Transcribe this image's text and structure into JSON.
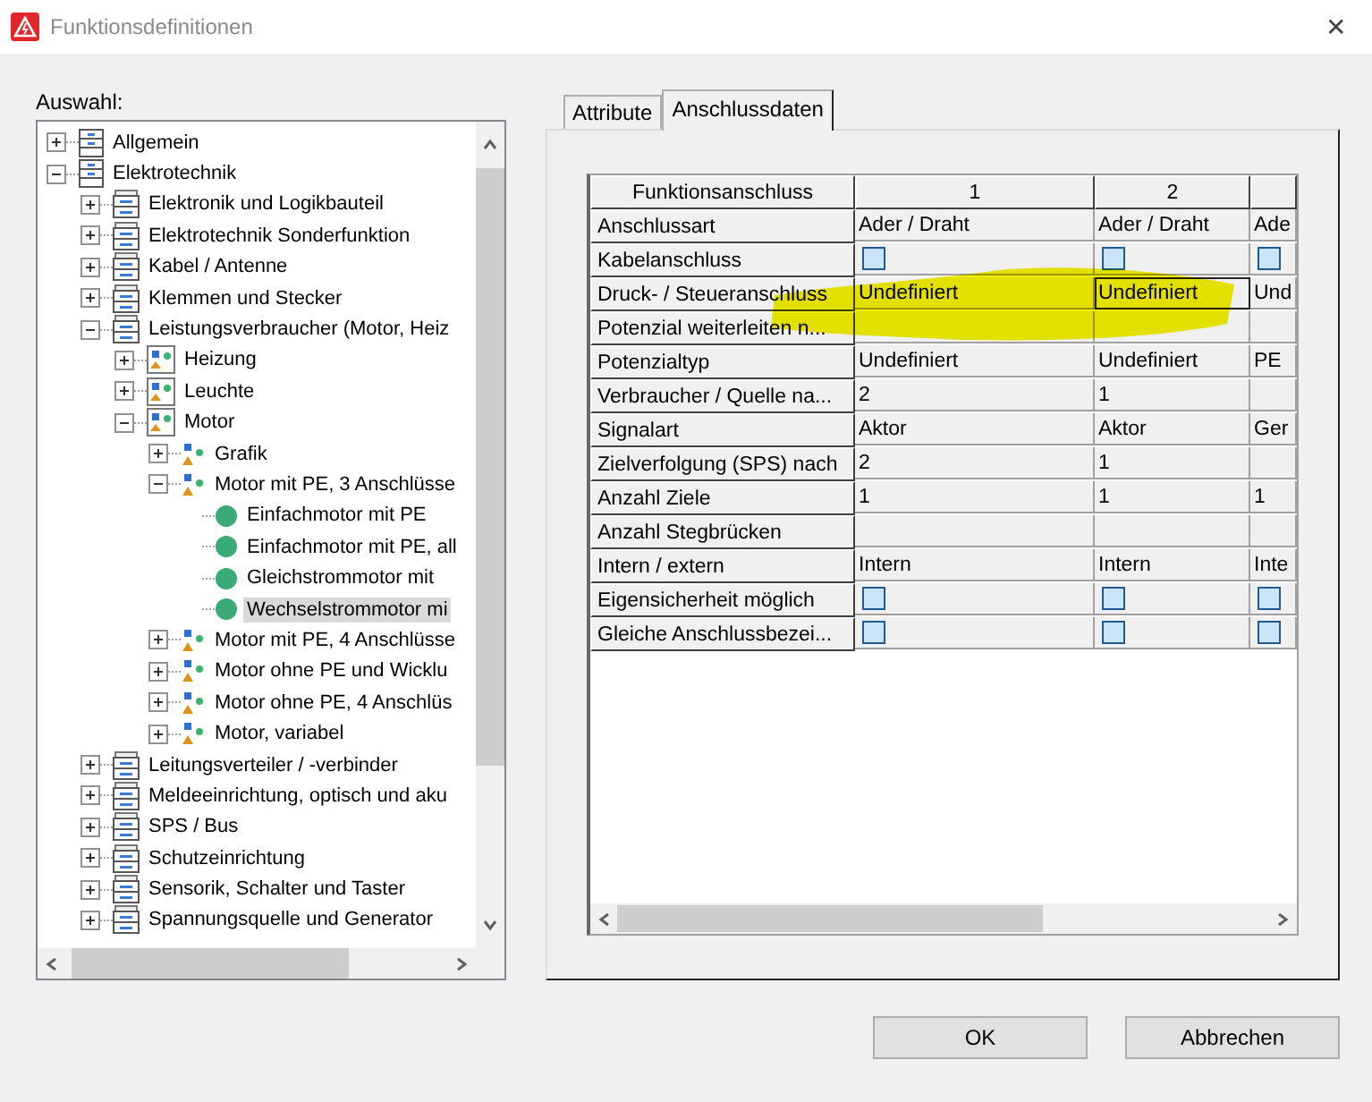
{
  "window": {
    "title": "Funktionsdefinitionen",
    "close": "✕"
  },
  "tree": {
    "label": "Auswahl:",
    "items": [
      {
        "label": "Allgemein",
        "kind": "folder",
        "expanded": false,
        "selected": false
      },
      {
        "label": "Elektrotechnik",
        "kind": "folder",
        "expanded": true,
        "selected": false,
        "children": [
          {
            "label": "Elektronik und Logikbauteil",
            "kind": "cabinet",
            "expanded": false,
            "selected": false
          },
          {
            "label": "Elektrotechnik Sonderfunktion",
            "kind": "cabinet",
            "expanded": false,
            "selected": false
          },
          {
            "label": "Kabel / Antenne",
            "kind": "cabinet",
            "expanded": false,
            "selected": false
          },
          {
            "label": "Klemmen und Stecker",
            "kind": "cabinet",
            "expanded": false,
            "selected": false
          },
          {
            "label": "Leistungsverbraucher (Motor, Heiz",
            "kind": "cabinet",
            "expanded": true,
            "selected": false,
            "children": [
              {
                "label": "Heizung",
                "kind": "group",
                "expanded": false,
                "selected": false
              },
              {
                "label": "Leuchte",
                "kind": "group",
                "expanded": false,
                "selected": false
              },
              {
                "label": "Motor",
                "kind": "group",
                "expanded": true,
                "selected": false,
                "children": [
                  {
                    "label": "Grafik",
                    "kind": "shape",
                    "expanded": false,
                    "selected": false
                  },
                  {
                    "label": "Motor mit PE, 3 Anschlüsse",
                    "kind": "shape",
                    "expanded": true,
                    "selected": false,
                    "children": [
                      {
                        "label": "Einfachmotor mit PE",
                        "kind": "dot",
                        "selected": false
                      },
                      {
                        "label": "Einfachmotor mit PE, all",
                        "kind": "dot",
                        "selected": false
                      },
                      {
                        "label": "Gleichstrommotor mit",
                        "kind": "dot",
                        "selected": false
                      },
                      {
                        "label": "Wechselstrommotor mi",
                        "kind": "dot",
                        "selected": true
                      }
                    ]
                  },
                  {
                    "label": "Motor mit PE, 4 Anschlüsse",
                    "kind": "shape",
                    "expanded": false,
                    "selected": false
                  },
                  {
                    "label": "Motor ohne PE und Wicklu",
                    "kind": "shape",
                    "expanded": false,
                    "selected": false
                  },
                  {
                    "label": "Motor ohne PE, 4 Anschlüs",
                    "kind": "shape",
                    "expanded": false,
                    "selected": false
                  },
                  {
                    "label": "Motor, variabel",
                    "kind": "shape",
                    "expanded": false,
                    "selected": false
                  }
                ]
              }
            ]
          },
          {
            "label": "Leitungsverteiler / -verbinder",
            "kind": "cabinet",
            "expanded": false,
            "selected": false
          },
          {
            "label": "Meldeeinrichtung, optisch und aku",
            "kind": "cabinet",
            "expanded": false,
            "selected": false
          },
          {
            "label": "SPS / Bus",
            "kind": "cabinet",
            "expanded": false,
            "selected": false
          },
          {
            "label": "Schutzeinrichtung",
            "kind": "cabinet",
            "expanded": false,
            "selected": false
          },
          {
            "label": "Sensorik, Schalter und Taster",
            "kind": "cabinet",
            "expanded": false,
            "selected": false
          },
          {
            "label": "Spannungsquelle und Generator",
            "kind": "cabinet",
            "expanded": false,
            "selected": false
          }
        ]
      }
    ]
  },
  "tabs": [
    {
      "label": "Attribute",
      "selected": false
    },
    {
      "label": "Anschlussdaten",
      "selected": true
    }
  ],
  "table": {
    "columns": [
      "Funktionsanschluss",
      "1",
      "2"
    ],
    "rows": [
      {
        "label": "Anschlussart",
        "cells": [
          {
            "kind": "text",
            "text": "Ader / Draht"
          },
          {
            "kind": "text",
            "text": "Ader / Draht"
          },
          {
            "kind": "text",
            "text": "Ade"
          }
        ]
      },
      {
        "label": "Kabelanschluss",
        "cells": [
          {
            "kind": "checkbox",
            "checked": false
          },
          {
            "kind": "checkbox",
            "checked": false
          },
          {
            "kind": "checkbox",
            "checked": false
          }
        ]
      },
      {
        "label": "Druck- / Steueranschluss",
        "cells": [
          {
            "kind": "text",
            "text": "Undefiniert"
          },
          {
            "kind": "text",
            "text": "Undefiniert",
            "focused": true
          },
          {
            "kind": "text",
            "text": "Und"
          }
        ]
      },
      {
        "label": "Potenzial weiterleiten n...",
        "cells": [
          {
            "kind": "empty"
          },
          {
            "kind": "empty"
          },
          {
            "kind": "empty"
          }
        ]
      },
      {
        "label": "Potenzialtyp",
        "cells": [
          {
            "kind": "text",
            "text": "Undefiniert"
          },
          {
            "kind": "text",
            "text": "Undefiniert"
          },
          {
            "kind": "text",
            "text": "PE"
          }
        ]
      },
      {
        "label": "Verbraucher / Quelle na...",
        "cells": [
          {
            "kind": "text",
            "text": "2"
          },
          {
            "kind": "text",
            "text": "1"
          },
          {
            "kind": "empty"
          }
        ]
      },
      {
        "label": "Signalart",
        "cells": [
          {
            "kind": "text",
            "text": "Aktor"
          },
          {
            "kind": "text",
            "text": "Aktor"
          },
          {
            "kind": "text",
            "text": "Ger"
          }
        ]
      },
      {
        "label": "Zielverfolgung (SPS) nach",
        "cells": [
          {
            "kind": "text",
            "text": "2"
          },
          {
            "kind": "text",
            "text": "1"
          },
          {
            "kind": "empty"
          }
        ]
      },
      {
        "label": "Anzahl Ziele",
        "cells": [
          {
            "kind": "text",
            "text": "1"
          },
          {
            "kind": "text",
            "text": "1"
          },
          {
            "kind": "text",
            "text": "1"
          }
        ]
      },
      {
        "label": "Anzahl Stegbrücken",
        "cells": [
          {
            "kind": "empty"
          },
          {
            "kind": "empty"
          },
          {
            "kind": "empty"
          }
        ]
      },
      {
        "label": "Intern / extern",
        "cells": [
          {
            "kind": "text",
            "text": "Intern"
          },
          {
            "kind": "text",
            "text": "Intern"
          },
          {
            "kind": "text",
            "text": "Inte"
          }
        ]
      },
      {
        "label": "Eigensicherheit möglich",
        "cells": [
          {
            "kind": "checkbox",
            "checked": false
          },
          {
            "kind": "checkbox",
            "checked": false
          },
          {
            "kind": "checkbox",
            "checked": false
          }
        ]
      },
      {
        "label": "Gleiche Anschlussbezei...",
        "cells": [
          {
            "kind": "checkbox",
            "checked": false
          },
          {
            "kind": "checkbox",
            "checked": false
          },
          {
            "kind": "checkbox",
            "checked": false
          }
        ]
      }
    ]
  },
  "buttons": [
    "OK",
    "Abbrechen"
  ]
}
